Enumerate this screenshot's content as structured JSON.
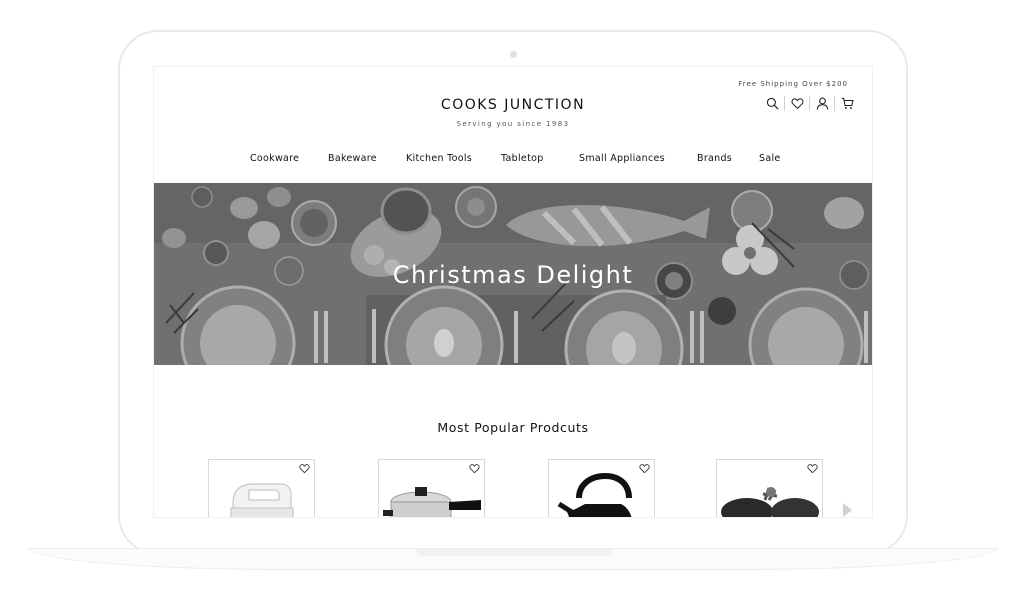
{
  "header": {
    "promo": "Free Shipping Over $200",
    "logo_title": "COOKS JUNCTION",
    "tagline": "Serving you since 1983"
  },
  "header_icons": [
    "search-icon",
    "heart-icon",
    "user-icon",
    "cart-icon"
  ],
  "nav": {
    "items": [
      {
        "label": "Cookware"
      },
      {
        "label": "Bakeware"
      },
      {
        "label": "Kitchen Tools"
      },
      {
        "label": "Tabletop"
      },
      {
        "label": "Small Appliances"
      },
      {
        "label": "Brands"
      },
      {
        "label": "Sale"
      }
    ]
  },
  "hero": {
    "title": "Christmas Delight"
  },
  "popular": {
    "title": "Most Popular Prodcuts",
    "products": [
      {
        "name": "hand-mixer",
        "favorite_icon": "heart-icon"
      },
      {
        "name": "pressure-cooker",
        "favorite_icon": "heart-icon"
      },
      {
        "name": "kettle",
        "favorite_icon": "heart-icon"
      },
      {
        "name": "serving-bowls",
        "favorite_icon": "heart-icon"
      }
    ]
  },
  "colors": {
    "text": "#111111",
    "border": "#d8d8d8",
    "hero_bg": "#7b7b7b"
  }
}
